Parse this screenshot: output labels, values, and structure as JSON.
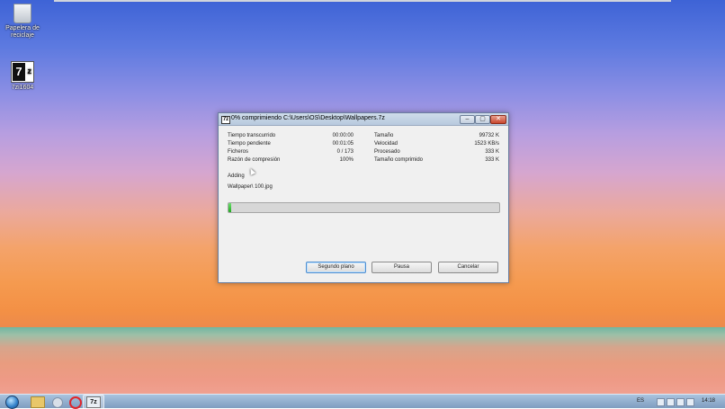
{
  "desktop": {
    "icons": [
      {
        "label": "Papelera de reciclaje"
      },
      {
        "label": "7zi1604"
      }
    ]
  },
  "window": {
    "title": "0% comprimiendo C:\\Users\\OS\\Desktop\\Wallpapers.7z",
    "controls": {
      "minimize": "–",
      "maximize": "▢",
      "close": "✕"
    },
    "stats_left": [
      {
        "label": "Tiempo transcurrido",
        "value": "00:00:00"
      },
      {
        "label": "Tiempo pendiente",
        "value": "00:01:05"
      },
      {
        "label": "Ficheros",
        "value": "0 / 173"
      },
      {
        "label": "Razón de compresión",
        "value": "100%"
      }
    ],
    "stats_right": [
      {
        "label": "Tamaño",
        "value": "99732 K"
      },
      {
        "label": "Velocidad",
        "value": "1523 KB/s"
      },
      {
        "label": "Procesado",
        "value": "333 K"
      },
      {
        "label": "Tamaño comprimido",
        "value": "333 K"
      }
    ],
    "action": "Adding",
    "current_file": "Wallpaper\\ 100.jpg",
    "progress_percent": 0.5,
    "buttons": {
      "background": "Segundo plano",
      "pause": "Pausa",
      "cancel": "Cancelar"
    }
  },
  "taskbar": {
    "language": "ES",
    "clock": "14:18",
    "accent_color": "#1fa91f"
  }
}
